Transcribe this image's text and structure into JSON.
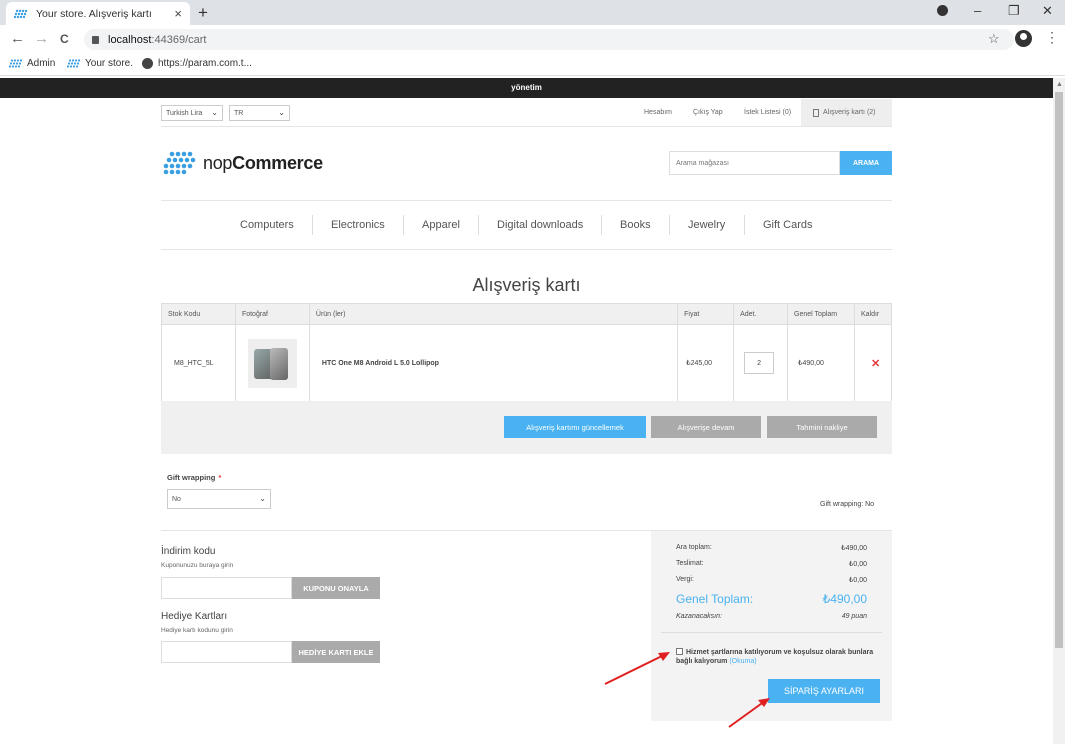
{
  "browser": {
    "tab_title": "Your store. Alışveriş kartı",
    "tab_close": "×",
    "new_tab": "+",
    "url_host": "localhost",
    "url_path": ":44369/cart",
    "back": "←",
    "forward": "→",
    "reload": "C",
    "star": "☆",
    "menu": "⋮",
    "window_controls": {
      "minimize": "–",
      "maximize": "❐",
      "close": "✕"
    },
    "bookmarks": [
      "Admin",
      "Your store.",
      "https://param.com.t..."
    ]
  },
  "admin_bar": {
    "label": "yönetim"
  },
  "header": {
    "currency": "Turkish Lira",
    "language": "TR",
    "links": [
      "Hesabım",
      "Çıkış Yap",
      "İstek Listesi (0)"
    ],
    "cart_link": "Alışveriş kartı (2)",
    "logo_light": "nop",
    "logo_bold": "Commerce",
    "search_placeholder": "Arama mağazası",
    "search_button": "ARAMA"
  },
  "menu": [
    "Computers",
    "Electronics",
    "Apparel",
    "Digital downloads",
    "Books",
    "Jewelry",
    "Gift Cards"
  ],
  "page_title": "Alışveriş kartı",
  "cart": {
    "columns": [
      "Stok Kodu",
      "Fotoğraf",
      "Ürün (ler)",
      "Fiyat",
      "Adet.",
      "Genel Toplam",
      "Kaldır"
    ],
    "rows": [
      {
        "sku": "M8_HTC_5L",
        "product": "HTC One M8 Android L 5.0 Lollipop",
        "price": "₺245,00",
        "qty": "2",
        "total": "₺490,00",
        "remove": "✕"
      }
    ],
    "buttons": {
      "update": "Alışveriş kartımı güncellemek",
      "continue": "Alışverişe devam",
      "estimate": "Tahmini nakliye"
    }
  },
  "gift_wrapping": {
    "label": "Gift wrapping",
    "required": "*",
    "selected": "No",
    "summary": "Gift wrapping: No"
  },
  "discount": {
    "title": "İndirim kodu",
    "hint": "Kuponunuzu buraya girin",
    "button": "KUPONU ONAYLA"
  },
  "giftcard": {
    "title": "Hediye Kartları",
    "hint": "Hediye kartı kodunu girin",
    "button": "HEDİYE KARTI EKLE"
  },
  "totals": {
    "subtotal_label": "Ara toplam:",
    "subtotal": "₺490,00",
    "shipping_label": "Teslimat:",
    "shipping": "₺0,00",
    "tax_label": "Vergi:",
    "tax": "₺0,00",
    "grand_label": "Genel Toplam:",
    "grand": "₺490,00",
    "points_label": "Kazanacaksın:",
    "points": "49 puan",
    "terms": "Hizmet şartlarına katılıyorum ve koşulsuz olarak bunlara bağlı kalıyorum",
    "terms_read": "(Okuma)",
    "checkout": "SİPARİŞ AYARLARI"
  },
  "colors": {
    "accent": "#4ab2f1",
    "remove": "#e4393c",
    "admin_bar": "#222222",
    "arrow": "#e02020"
  }
}
